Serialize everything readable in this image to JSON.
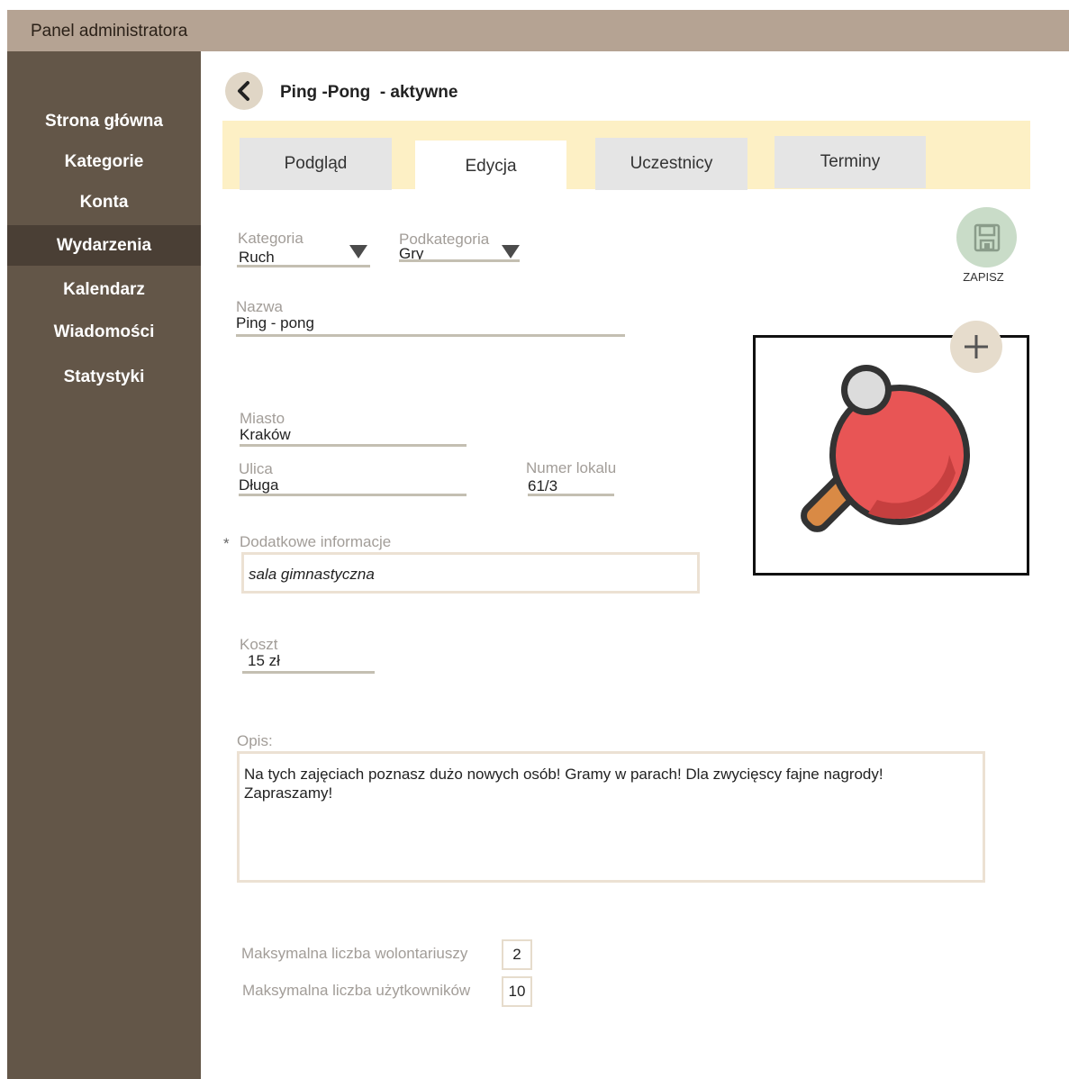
{
  "header": {
    "title": "Panel administratora"
  },
  "sidebar": {
    "items": [
      {
        "label": "Strona główna"
      },
      {
        "label": "Kategorie"
      },
      {
        "label": "Konta"
      },
      {
        "label": "Wydarzenia",
        "active": true
      },
      {
        "label": "Kalendarz"
      },
      {
        "label": "Wiadomości"
      },
      {
        "label": "Statystyki"
      }
    ]
  },
  "page": {
    "title": "Ping -Pong  - aktywne"
  },
  "tabs": [
    {
      "label": "Podgląd"
    },
    {
      "label": "Edycja",
      "active": true
    },
    {
      "label": "Uczestnicy"
    },
    {
      "label": "Terminy"
    }
  ],
  "form": {
    "category": {
      "label": "Kategoria",
      "value": "Ruch"
    },
    "subcategory": {
      "label": "Podkategoria",
      "value": "Gry"
    },
    "name": {
      "label": "Nazwa",
      "value": "Ping - pong"
    },
    "city": {
      "label": "Miasto",
      "value": "Kraków"
    },
    "street": {
      "label": "Ulica",
      "value": "Długa"
    },
    "unit": {
      "label": "Numer lokalu",
      "value": "61/3"
    },
    "additional": {
      "asterisk": "*",
      "label": "Dodatkowe informacje",
      "value": "sala gimnastyczna"
    },
    "cost": {
      "label": "Koszt",
      "value": "15 zł"
    },
    "description": {
      "label": "Opis:",
      "line1": "Na tych zajęciach poznasz dużo nowych osób! Gramy w parach! Dla zwycięscy fajne nagrody!",
      "line2": "Zapraszamy!"
    },
    "max_volunteers": {
      "label": "Maksymalna liczba wolontariuszy",
      "value": "2"
    },
    "max_users": {
      "label": "Maksymalna liczba użytkowników",
      "value": "10"
    }
  },
  "actions": {
    "save_label": "ZAPISZ"
  },
  "icons": {
    "back": "chevron-left-icon",
    "save": "floppy-disk-icon",
    "add": "plus-icon",
    "image": "ping-pong-paddle-icon",
    "dropdown": "triangle-down-icon"
  },
  "colors": {
    "topbar": "#b5a393",
    "sidebar": "#635648",
    "sidebar_active": "#4a3f35",
    "tabbar": "#fdf0c5",
    "save_button": "#c9dcc8",
    "paddle": "#e85555"
  }
}
